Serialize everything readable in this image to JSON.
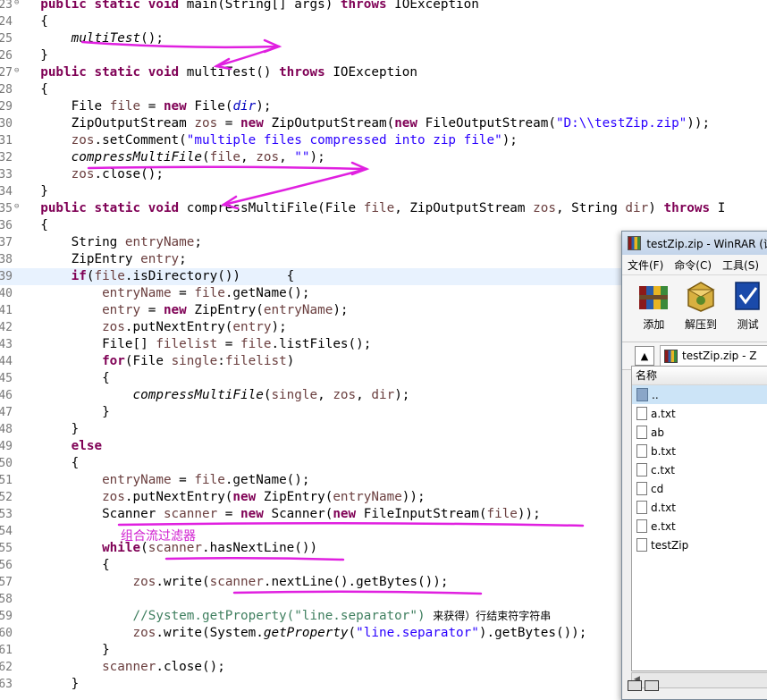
{
  "editor": {
    "lines": [
      {
        "n": "23",
        "fold": true,
        "html": "<span class=\"kw\">public static void</span> main(String[] args) <span class=\"kw\">throws</span> IOException"
      },
      {
        "n": "24",
        "html": "{"
      },
      {
        "n": "25",
        "html": "    <span class=\"st\">multiTest</span>();"
      },
      {
        "n": "26",
        "html": "}"
      },
      {
        "n": "27",
        "fold": true,
        "html": "<span class=\"kw\">public static void</span> multiTest() <span class=\"kw\">throws</span> IOException"
      },
      {
        "n": "28",
        "html": "{"
      },
      {
        "n": "29",
        "html": "    File <span class=\"var\">file</span> = <span class=\"kw\">new</span> File(<span class=\"fld st\">dir</span>);"
      },
      {
        "n": "30",
        "html": "    ZipOutputStream <span class=\"var\">zos</span> = <span class=\"kw\">new</span> ZipOutputStream(<span class=\"kw\">new</span> FileOutputStream(<span class=\"str\">\"D:\\\\testZip.zip\"</span>));"
      },
      {
        "n": "31",
        "html": "    <span class=\"var\">zos</span>.setComment(<span class=\"str\">\"multiple files compressed into zip file\"</span>);"
      },
      {
        "n": "32",
        "html": "    <span class=\"st\">compressMultiFile</span>(<span class=\"var\">file</span>, <span class=\"var\">zos</span>, <span class=\"str\">\"\"</span>);"
      },
      {
        "n": "33",
        "html": "    <span class=\"var\">zos</span>.close();"
      },
      {
        "n": "34",
        "html": "}"
      },
      {
        "n": "35",
        "fold": true,
        "html": "<span class=\"kw\">public static void</span> compressMultiFile(File <span class=\"var\">file</span>, ZipOutputStream <span class=\"var\">zos</span>, String <span class=\"var\">dir</span>) <span class=\"kw\">throws</span> I"
      },
      {
        "n": "36",
        "html": "{"
      },
      {
        "n": "37",
        "html": "    String <span class=\"var\">entryName</span>;"
      },
      {
        "n": "38",
        "html": "    ZipEntry <span class=\"var\">entry</span>;"
      },
      {
        "n": "39",
        "hl": true,
        "html": "    <span class=\"kw\">if</span>(<span class=\"var\">file</span>.isDirectory())      {"
      },
      {
        "n": "40",
        "html": "        <span class=\"var\">entryName</span> = <span class=\"var\">file</span>.getName();"
      },
      {
        "n": "41",
        "html": "        <span class=\"var\">entry</span> = <span class=\"kw\">new</span> ZipEntry(<span class=\"var\">entryName</span>);"
      },
      {
        "n": "42",
        "html": "        <span class=\"var\">zos</span>.putNextEntry(<span class=\"var\">entry</span>);"
      },
      {
        "n": "43",
        "html": "        File[] <span class=\"var\">filelist</span> = <span class=\"var\">file</span>.listFiles();"
      },
      {
        "n": "44",
        "html": "        <span class=\"kw\">for</span>(File <span class=\"var\">single</span>:<span class=\"var\">filelist</span>)"
      },
      {
        "n": "45",
        "html": "        {"
      },
      {
        "n": "46",
        "html": "            <span class=\"st\">compressMultiFile</span>(<span class=\"var\">single</span>, <span class=\"var\">zos</span>, <span class=\"var\">dir</span>);"
      },
      {
        "n": "47",
        "html": "        }"
      },
      {
        "n": "48",
        "html": "    }"
      },
      {
        "n": "49",
        "html": "    <span class=\"kw\">else</span>"
      },
      {
        "n": "50",
        "html": "    {"
      },
      {
        "n": "51",
        "html": "        <span class=\"var\">entryName</span> = <span class=\"var\">file</span>.getName();"
      },
      {
        "n": "52",
        "html": "        <span class=\"var\">zos</span>.putNextEntry(<span class=\"kw\">new</span> ZipEntry(<span class=\"var\">entryName</span>));"
      },
      {
        "n": "53",
        "html": "        Scanner <span class=\"var\">scanner</span> = <span class=\"kw\">new</span> Scanner(<span class=\"kw\">new</span> FileInputStream(<span class=\"var\">file</span>));"
      },
      {
        "n": "54",
        "html": ""
      },
      {
        "n": "55",
        "html": "        <span class=\"kw\">while</span>(<span class=\"var\">scanner</span>.hasNextLine())"
      },
      {
        "n": "56",
        "html": "        {"
      },
      {
        "n": "57",
        "html": "            <span class=\"var\">zos</span>.write(<span class=\"var\">scanner</span>.nextLine().getBytes());"
      },
      {
        "n": "58",
        "html": ""
      },
      {
        "n": "59",
        "html": "            <span class=\"cmt\">//System.getProperty(\"line.separator\")</span> <span class=\"cjk\">来获得）行结束符字符串</span>"
      },
      {
        "n": "60",
        "html": "            <span class=\"var\">zos</span>.write(System.<span class=\"st\">getProperty</span>(<span class=\"str\">\"line.separator\"</span>).getBytes());"
      },
      {
        "n": "61",
        "html": "        }"
      },
      {
        "n": "62",
        "html": "        <span class=\"var\">scanner</span>.close();"
      },
      {
        "n": "63",
        "html": "    }"
      }
    ],
    "annotation": "组合流过滤器"
  },
  "winrar": {
    "title": "testZip.zip - WinRAR (评",
    "menu": [
      "文件(F)",
      "命令(C)",
      "工具(S)"
    ],
    "toolbar": [
      "添加",
      "解压到",
      "测试"
    ],
    "path": "testZip.zip - Z",
    "column_header": "名称",
    "files": [
      {
        "name": "..",
        "type": "folder",
        "selected": true
      },
      {
        "name": "a.txt",
        "type": "file"
      },
      {
        "name": "ab",
        "type": "file"
      },
      {
        "name": "b.txt",
        "type": "file"
      },
      {
        "name": "c.txt",
        "type": "file"
      },
      {
        "name": "cd",
        "type": "file"
      },
      {
        "name": "d.txt",
        "type": "file"
      },
      {
        "name": "e.txt",
        "type": "file"
      },
      {
        "name": "testZip",
        "type": "file"
      }
    ]
  },
  "colors": {
    "keyword": "#7f0055",
    "string": "#2a00ff",
    "field": "#0000c0",
    "local_var": "#6a3e3e",
    "comment": "#3f7f5f",
    "annotation": "#d020d0",
    "line_highlight": "#e8f2fe"
  }
}
